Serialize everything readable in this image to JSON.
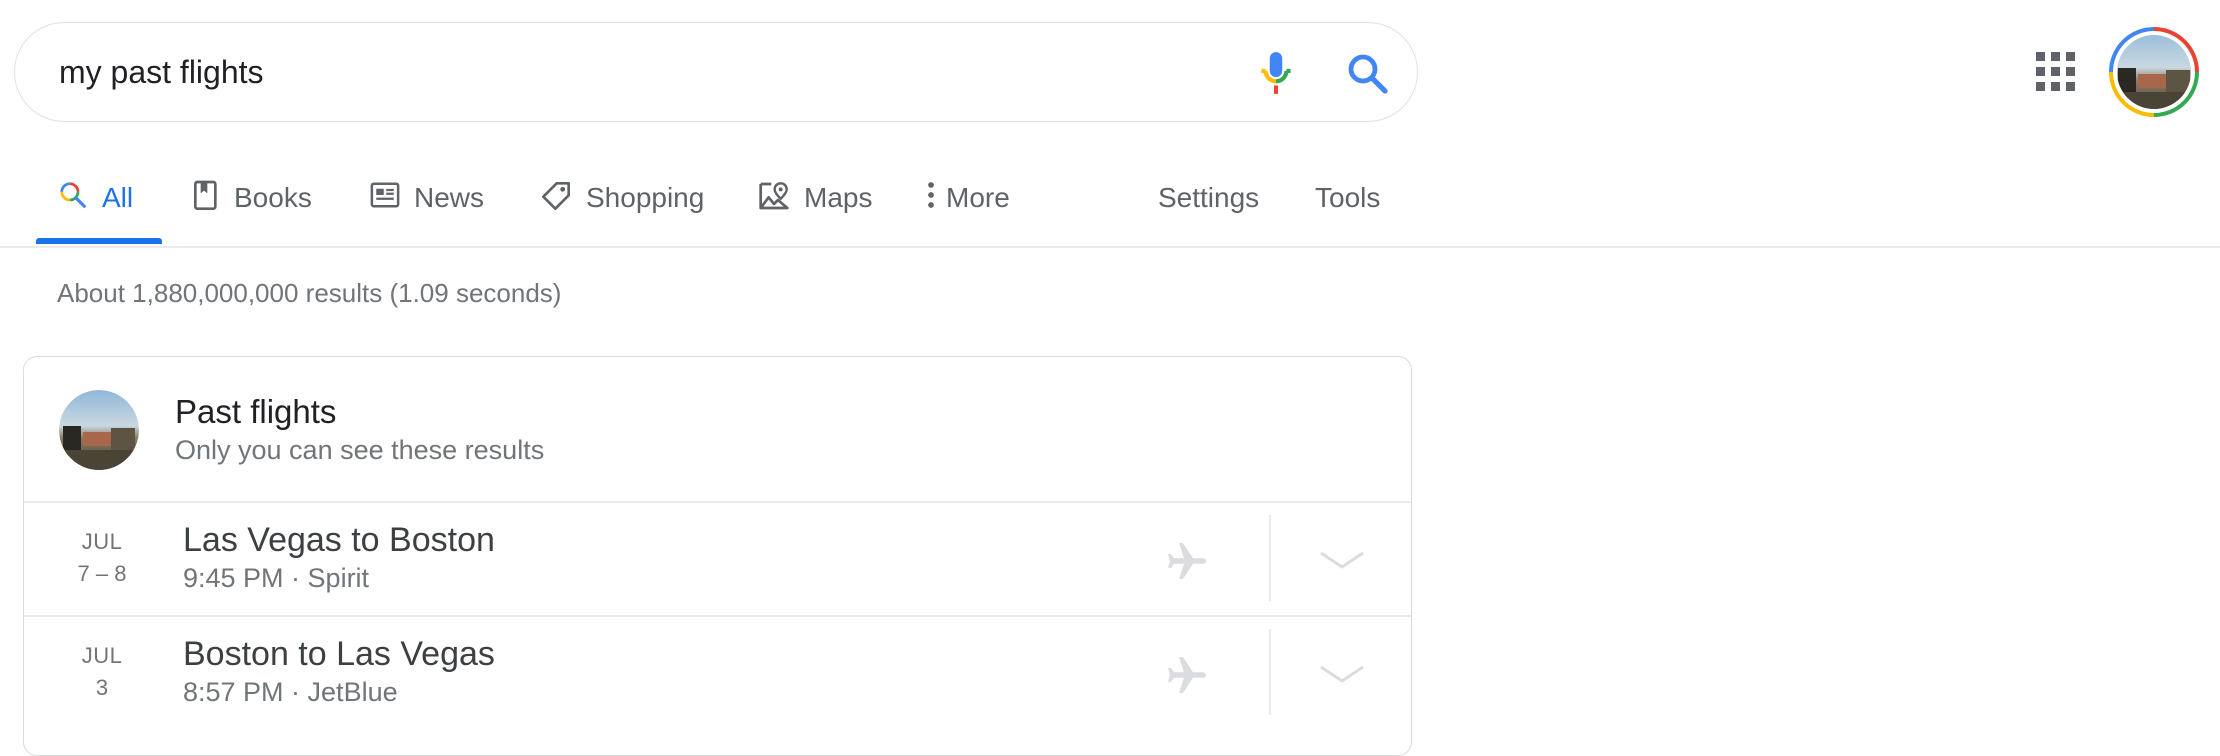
{
  "search": {
    "query": "my past flights"
  },
  "tabs": [
    {
      "label": "All",
      "icon": "search-multicolor-icon",
      "active": true
    },
    {
      "label": "Books",
      "icon": "bookmark-icon"
    },
    {
      "label": "News",
      "icon": "newspaper-icon"
    },
    {
      "label": "Shopping",
      "icon": "tag-icon"
    },
    {
      "label": "Maps",
      "icon": "map-pin-icon"
    },
    {
      "label": "More",
      "icon": "vertical-dots-icon"
    },
    {
      "label": "Settings"
    },
    {
      "label": "Tools"
    }
  ],
  "stats": "About 1,880,000,000 results (1.09 seconds)",
  "card": {
    "title": "Past flights",
    "subtitle": "Only you can see these results",
    "flights": [
      {
        "month": "JUL",
        "days": "7 – 8",
        "route": "Las Vegas to Boston",
        "detail": "9:45 PM · Spirit"
      },
      {
        "month": "JUL",
        "days": "3",
        "route": "Boston to Las Vegas",
        "detail": "8:57 PM · JetBlue"
      }
    ]
  },
  "colors": {
    "accent": "#1a73e8",
    "google_red": "#ea4335",
    "google_yellow": "#fbbc05",
    "google_green": "#34a853"
  }
}
